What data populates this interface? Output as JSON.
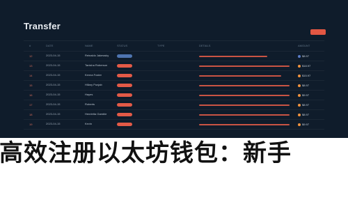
{
  "window": {
    "title": "Transfer"
  },
  "table": {
    "headers": [
      "#",
      "Date",
      "Name",
      "Status",
      "Type",
      "Details",
      "Amount"
    ],
    "rows": [
      {
        "id": "12",
        "date": "2023-04-15",
        "name": "Reinaldo\nJakewsky",
        "status": "Pending",
        "type": "",
        "tail": "$8.97"
      },
      {
        "id": "13",
        "date": "2023-04-15",
        "name": "Tanisha\nRoberson",
        "status": "",
        "type": "",
        "tail": "$18.97"
      },
      {
        "id": "14",
        "date": "2023-04-15",
        "name": "Kenna\nFoster",
        "status": "",
        "type": "",
        "tail": "$15.97"
      },
      {
        "id": "15",
        "date": "2023-04-15",
        "name": "Hillary\nPunjab",
        "status": "",
        "type": "",
        "tail": "$8.97"
      },
      {
        "id": "16",
        "date": "2023-04-15",
        "name": "Hayes",
        "status": "",
        "type": "",
        "tail": "$9.97"
      },
      {
        "id": "17",
        "date": "2023-04-15",
        "name": "Roberts",
        "status": "",
        "type": "",
        "tail": "$8.97"
      },
      {
        "id": "18",
        "date": "2023-04-15",
        "name": "Henrietta\nGamble",
        "status": "",
        "type": "",
        "tail": "$8.97"
      },
      {
        "id": "19",
        "date": "2023-04-15",
        "name": "Kevin",
        "status": "",
        "type": "",
        "tail": "$9.97"
      }
    ]
  },
  "headline": "高效注册以太坊钱包：新手"
}
